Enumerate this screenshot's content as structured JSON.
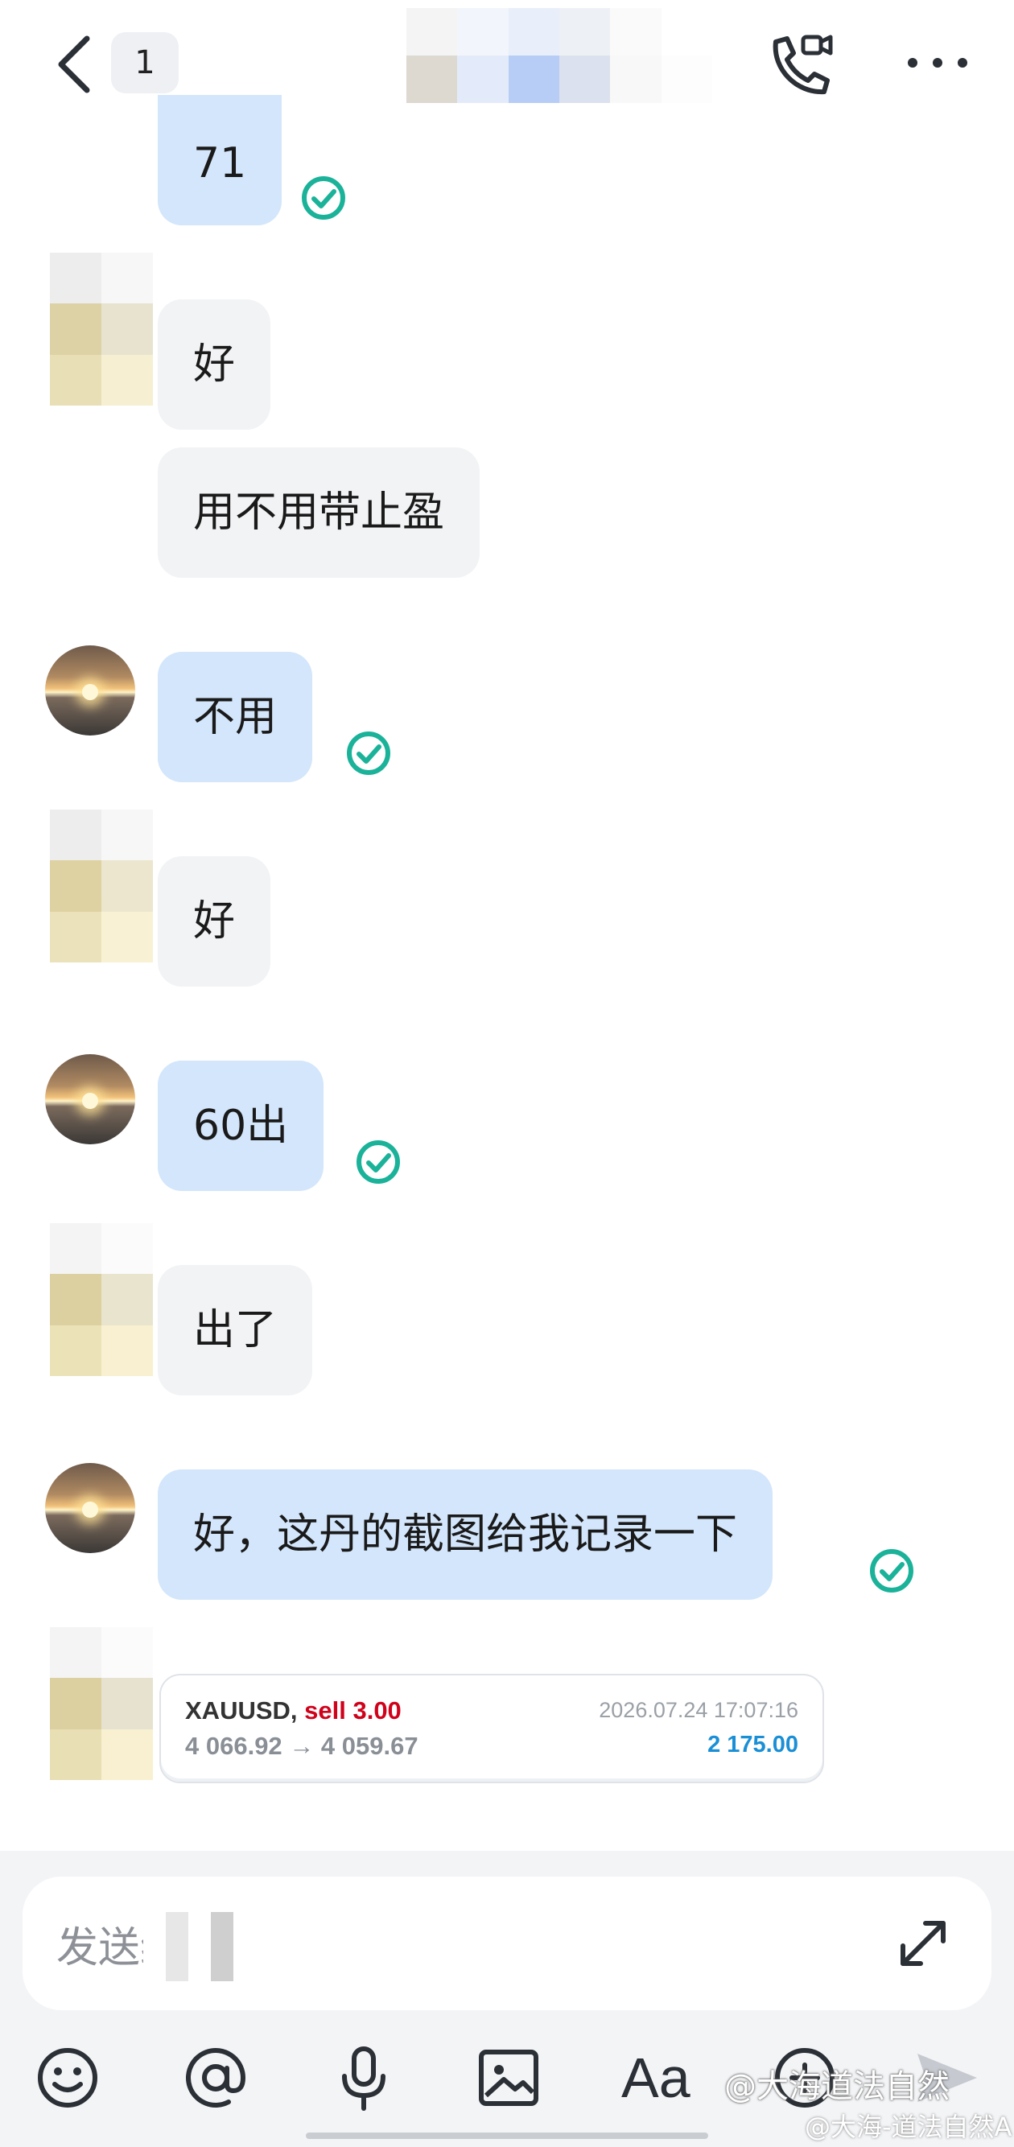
{
  "header": {
    "back_icon": "chevron-left-icon",
    "unread_badge": "1",
    "call_icon": "video-call-icon",
    "menu_icon": "more-dots-icon"
  },
  "messages": [
    {
      "from": "me",
      "text": "71",
      "status_icon": "check-circle-icon"
    },
    {
      "from": "other",
      "text": "好"
    },
    {
      "from": "other",
      "text": "用不用带止盈"
    },
    {
      "from": "me",
      "text": "不用",
      "status_icon": "check-circle-icon"
    },
    {
      "from": "other",
      "text": "好"
    },
    {
      "from": "me",
      "text": "60出",
      "status_icon": "check-circle-icon"
    },
    {
      "from": "other",
      "text": "出了"
    },
    {
      "from": "me",
      "text": "好，这丹的截图给我记录一下",
      "status_icon": "check-circle-icon"
    }
  ],
  "trade_card": {
    "symbol": "XAUUSD,",
    "side": "sell 3.00",
    "prices": "4 066.92 → 4 059.67",
    "timestamp": "2026.07.24 17:07:16",
    "profit": "2 175.00",
    "side_color": "#d0021b",
    "profit_color": "#1a8fd6"
  },
  "composer": {
    "placeholder": "发送给",
    "expand_icon": "expand-arrows-icon"
  },
  "toolbar": {
    "emoji_icon": "emoji-icon",
    "mention_icon": "at-icon",
    "voice_icon": "microphone-icon",
    "image_icon": "image-icon",
    "text_format_label": "Aa",
    "add_icon": "add-icon",
    "send_icon": "send-icon"
  },
  "watermark": {
    "line1": "@大海道法自然",
    "line2": "@大海-道法自然A"
  },
  "colors": {
    "my_bubble": "#d3e6fb",
    "their_bubble": "#f2f3f5",
    "check": "#1bb29a"
  }
}
